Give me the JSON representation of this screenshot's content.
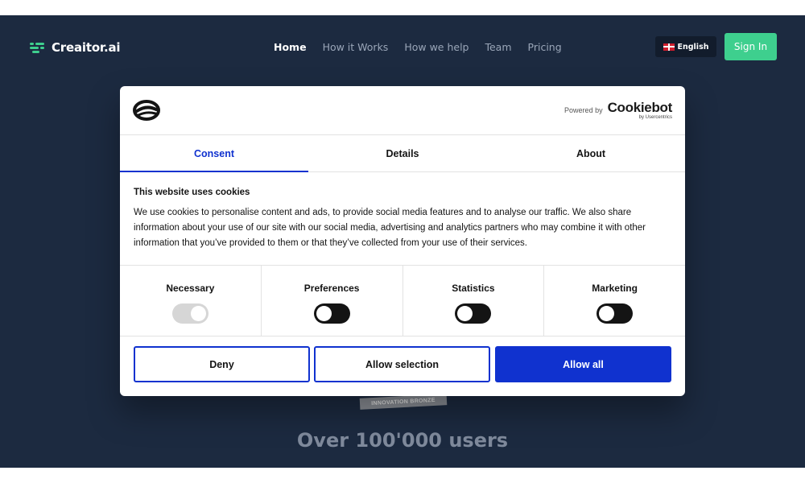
{
  "site": {
    "brand": "Creaitor.ai",
    "nav": [
      "Home",
      "How it Works",
      "How we help",
      "Team",
      "Pricing"
    ],
    "language": "English",
    "signin": "Sign In",
    "badge": "INNOVATION BRONZE",
    "headline": "Over 100'000 users"
  },
  "cookie": {
    "powered_by": "Powered by",
    "cookiebot": "Cookiebot",
    "cookiebot_sub": "by Usercentrics",
    "tabs": [
      "Consent",
      "Details",
      "About"
    ],
    "title": "This website uses cookies",
    "text": "We use cookies to personalise content and ads, to provide social media features and to analyse our traffic. We also share information about your use of our site with our social media, advertising and analytics partners who may combine it with other information that you’ve provided to them or that they’ve collected from your use of their services.",
    "categories": [
      "Necessary",
      "Preferences",
      "Statistics",
      "Marketing"
    ],
    "buttons": {
      "deny": "Deny",
      "allow_selection": "Allow selection",
      "allow_all": "Allow all"
    }
  },
  "colors": {
    "site_bg": "#1c2a40",
    "accent_blue": "#1032cf",
    "signin_green": "#3ecf8e"
  },
  "toggle_states": {
    "Necessary": "on-disabled",
    "Preferences": "off",
    "Statistics": "off",
    "Marketing": "off"
  }
}
